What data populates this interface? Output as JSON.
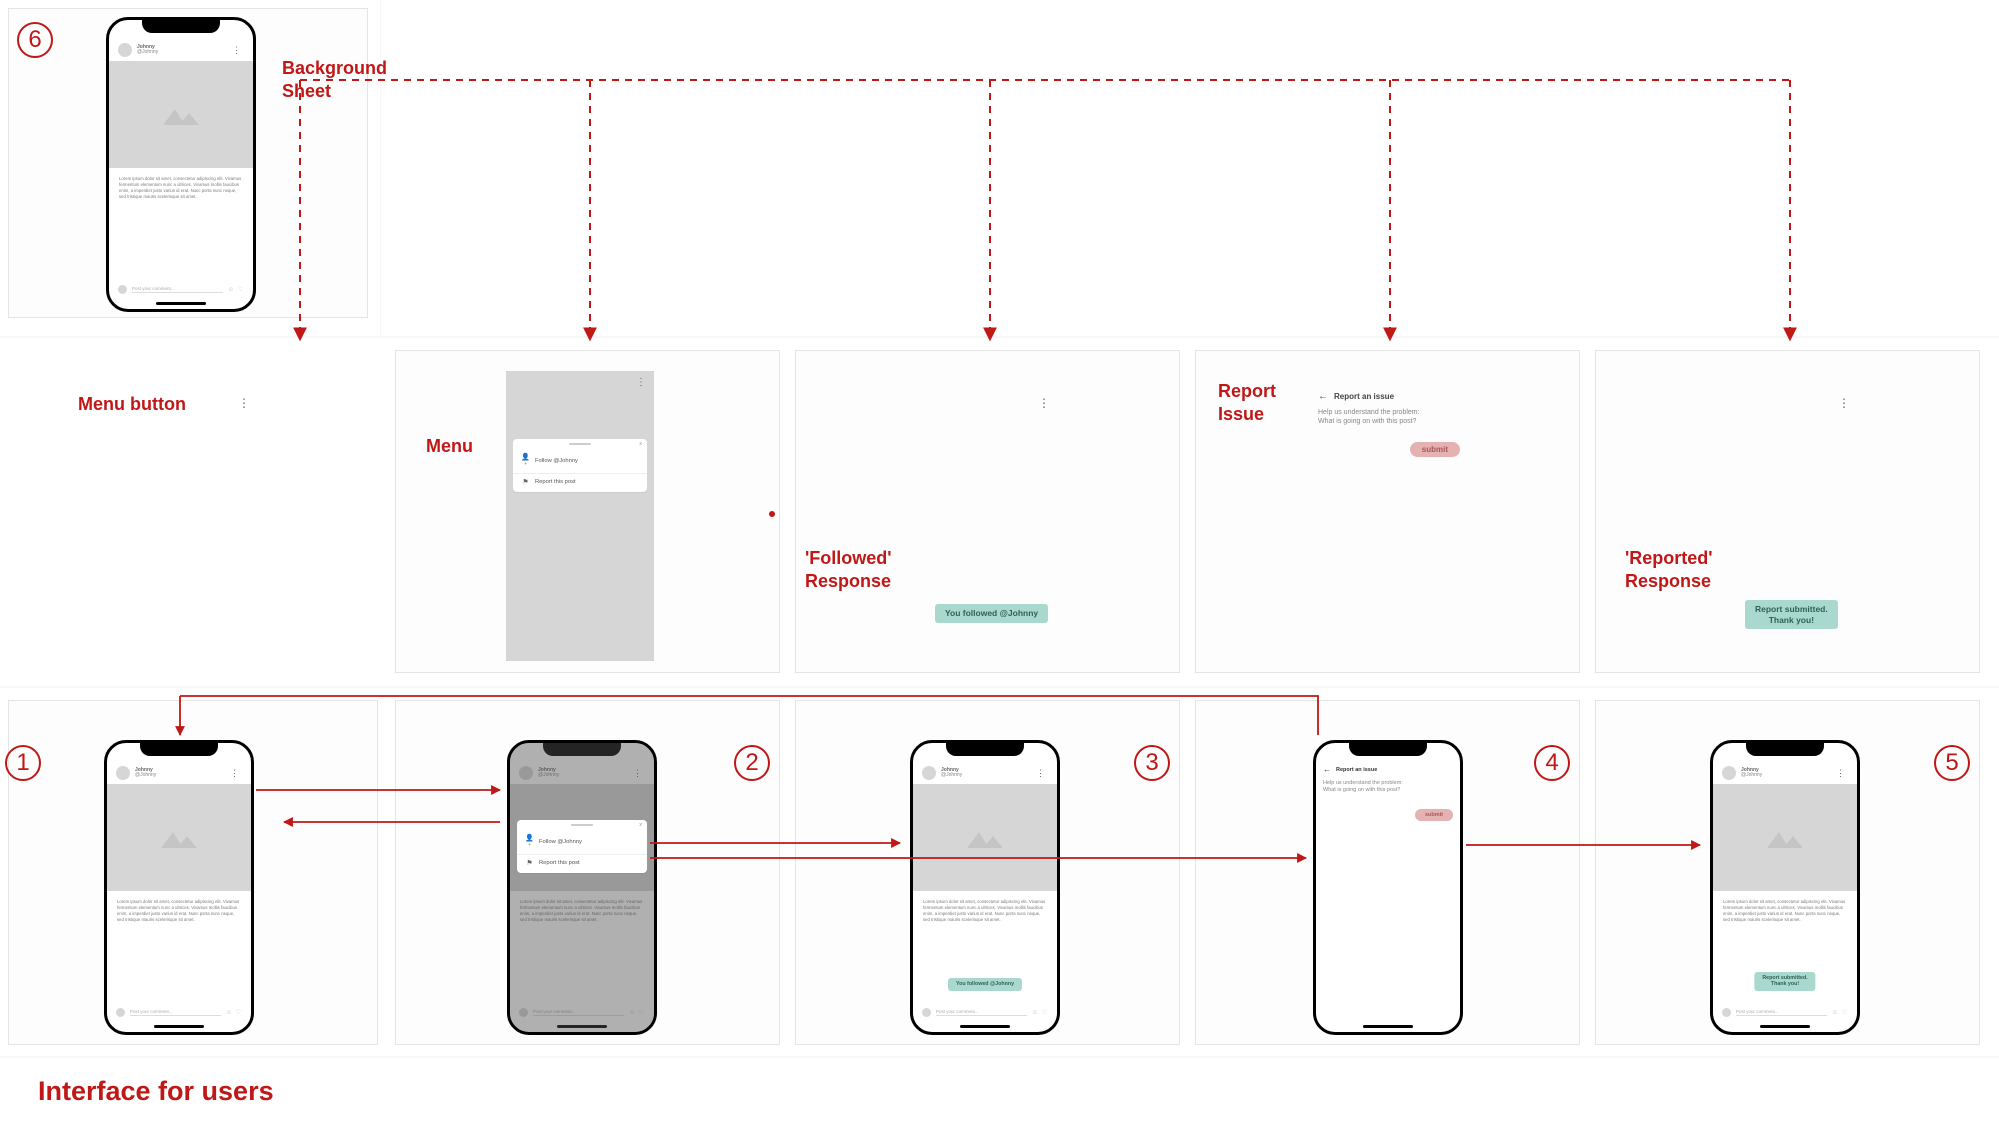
{
  "labels": {
    "background_sheet": "Background\nSheet",
    "menu_button": "Menu button",
    "menu": "Menu",
    "followed_response": "'Followed'\nResponse",
    "report_issue": "Report\nIssue",
    "reported_response": "'Reported'\nResponse",
    "interface_for_users": "Interface for users"
  },
  "steps": {
    "s1": "1",
    "s2": "2",
    "s3": "3",
    "s4": "4",
    "s5": "5",
    "s6": "6"
  },
  "post": {
    "display_name": "Johnny",
    "handle": "@Johnny",
    "body": "Lorem ipsum dolor sit amet, consectetur adipiscing elit. Vivamus fermentum elementum nunc a ultrices. Vivamus mollis faucibus enim, a imperdiet justo varius id erat. Nunc porta nunc neque, sed tristique mauris scelerisque sit amet.",
    "comment_placeholder": "Post your comment..."
  },
  "menu": {
    "follow": "Follow @Johnny",
    "report": "Report this post",
    "close": "x"
  },
  "report": {
    "title": "Report an issue",
    "prompt": "Help us understand the problem:\nWhat is going on with this post?",
    "submit": "submit"
  },
  "toasts": {
    "followed": "You followed @Johnny",
    "reported": "Report submitted.\nThank you!"
  }
}
